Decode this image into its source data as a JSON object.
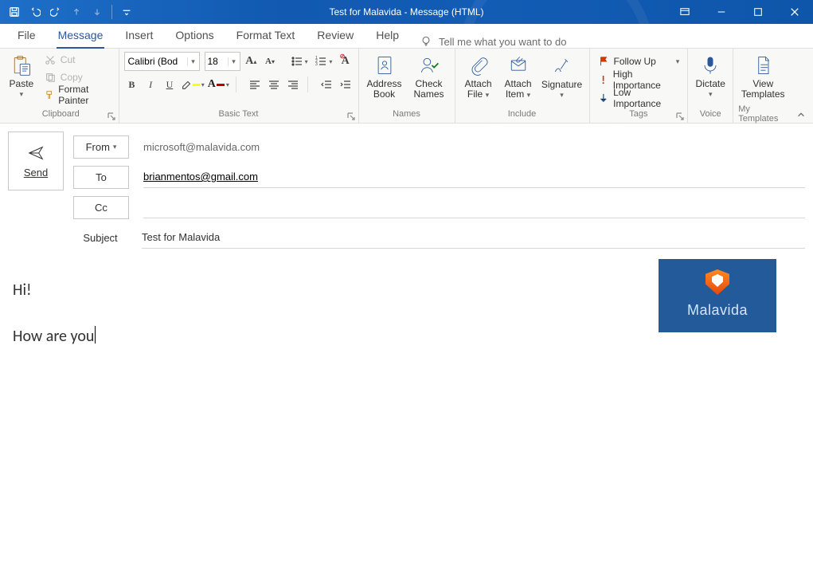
{
  "titlebar": {
    "caption": "Test for Malavida  -  Message (HTML)"
  },
  "tabs": {
    "file": "File",
    "message": "Message",
    "insert": "Insert",
    "options": "Options",
    "formatText": "Format Text",
    "review": "Review",
    "help": "Help",
    "tellMe": "Tell me what you want to do"
  },
  "ribbon": {
    "clipboard": {
      "label": "Clipboard",
      "paste": "Paste",
      "cut": "Cut",
      "copy": "Copy",
      "formatPainter": "Format Painter"
    },
    "basicText": {
      "label": "Basic Text",
      "fontName": "Calibri (Bod",
      "fontSize": "18"
    },
    "names": {
      "label": "Names",
      "addressBook": "Address Book",
      "checkNames": "Check Names"
    },
    "include": {
      "label": "Include",
      "attachFile": "Attach File",
      "attachItem": "Attach Item",
      "signature": "Signature"
    },
    "tags": {
      "label": "Tags",
      "followUp": "Follow Up",
      "highImportance": "High Importance",
      "lowImportance": "Low Importance"
    },
    "voice": {
      "label": "Voice",
      "dictate": "Dictate"
    },
    "myTemplates": {
      "label": "My Templates",
      "viewTemplates": "View Templates"
    }
  },
  "compose": {
    "send": "Send",
    "fromBtn": "From",
    "fromValue": "microsoft@malavida.com",
    "toBtn": "To",
    "toValue": "brianmentos@gmail.com",
    "ccBtn": "Cc",
    "ccValue": "",
    "subjectLabel": "Subject",
    "subjectValue": "Test for Malavida"
  },
  "body": {
    "line1": "Hi!",
    "line2": "How are you"
  },
  "embed": {
    "brand": "Malavida"
  }
}
